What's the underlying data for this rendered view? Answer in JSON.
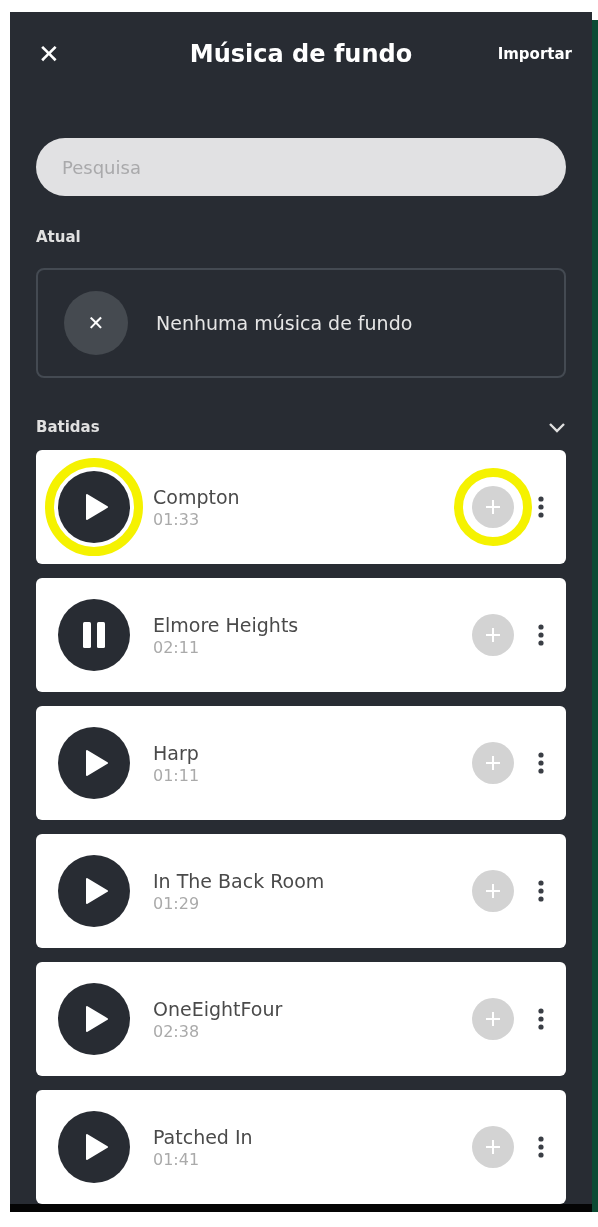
{
  "header": {
    "close": "✕",
    "title": "Música de fundo",
    "action": "Importar"
  },
  "search": {
    "placeholder": "Pesquisa"
  },
  "current": {
    "label": "Atual",
    "clear": "✕",
    "text": "Nenhuma música de fundo"
  },
  "section": {
    "title": "Batidas",
    "expanded": true
  },
  "tracks": [
    {
      "title": "Compton",
      "duration": "01:33",
      "playing": false,
      "circled": true
    },
    {
      "title": "Elmore Heights",
      "duration": "02:11",
      "playing": true,
      "circled": false
    },
    {
      "title": "Harp",
      "duration": "01:11",
      "playing": false,
      "circled": false
    },
    {
      "title": "In The Back Room",
      "duration": "01:29",
      "playing": false,
      "circled": false
    },
    {
      "title": "OneEightFour",
      "duration": "02:38",
      "playing": false,
      "circled": false
    },
    {
      "title": "Patched In",
      "duration": "01:41",
      "playing": false,
      "circled": false
    }
  ]
}
